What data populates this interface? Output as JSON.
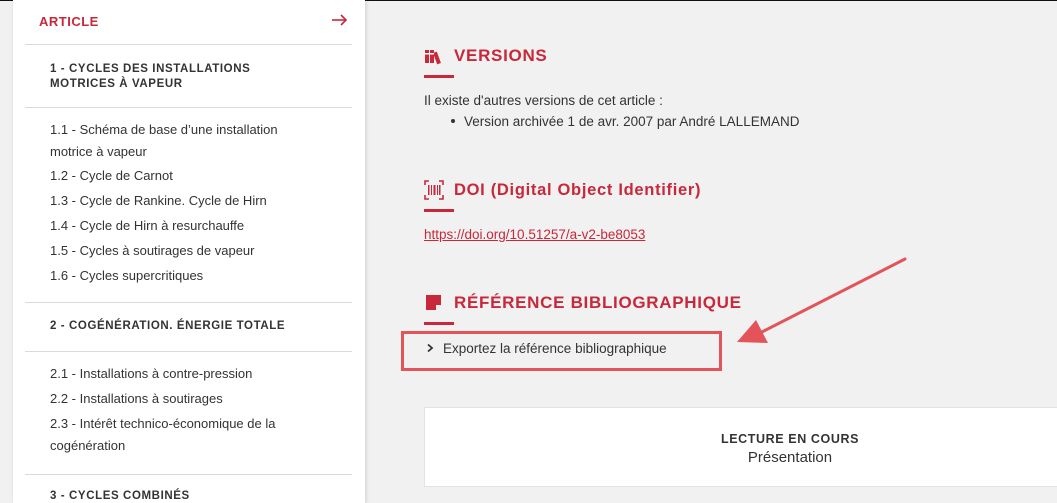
{
  "colors": {
    "accent": "#c8283a",
    "annotation": "#e2545a",
    "text": "#333333"
  },
  "sidebar": {
    "title": "ARTICLE",
    "title_icon": "arrow-right-icon",
    "sections": [
      {
        "title": "1 - CYCLES DES INSTALLATIONS MOTRICES À VAPEUR",
        "items": [
          "1.1 - Schéma de base d’une installation motrice à vapeur",
          "1.2 - Cycle de Carnot",
          "1.3 - Cycle de Rankine. Cycle de Hirn",
          "1.4 - Cycle de Hirn à resurchauffe",
          "1.5 - Cycles à soutirages de vapeur",
          "1.6 - Cycles supercritiques"
        ]
      },
      {
        "title": "2 - COGÉNÉRATION. ÉNERGIE TOTALE",
        "items": [
          "2.1 - Installations à contre-pression",
          "2.2 - Installations à soutirages",
          "2.3 - Intérêt technico-économique de la cogénération"
        ]
      },
      {
        "title": "3 - CYCLES COMBINÉS",
        "items": []
      }
    ]
  },
  "main": {
    "versions": {
      "icon": "books-icon",
      "heading": "VERSIONS",
      "intro": "Il existe d'autres versions de cet article :",
      "items": [
        "Version archivée 1 de avr. 2007 par André LALLEMAND"
      ]
    },
    "doi": {
      "icon": "barcode-icon",
      "heading": "DOI (Digital Object Identifier)",
      "link": "https://doi.org/10.51257/a-v2-be8053"
    },
    "reference": {
      "icon": "note-icon",
      "heading": "RÉFÉRENCE BIBLIOGRAPHIQUE",
      "export_label": "Exportez la référence bibliographique",
      "export_icon": "chevron-right-icon"
    },
    "reading": {
      "label": "LECTURE EN COURS",
      "value": "Présentation"
    }
  }
}
